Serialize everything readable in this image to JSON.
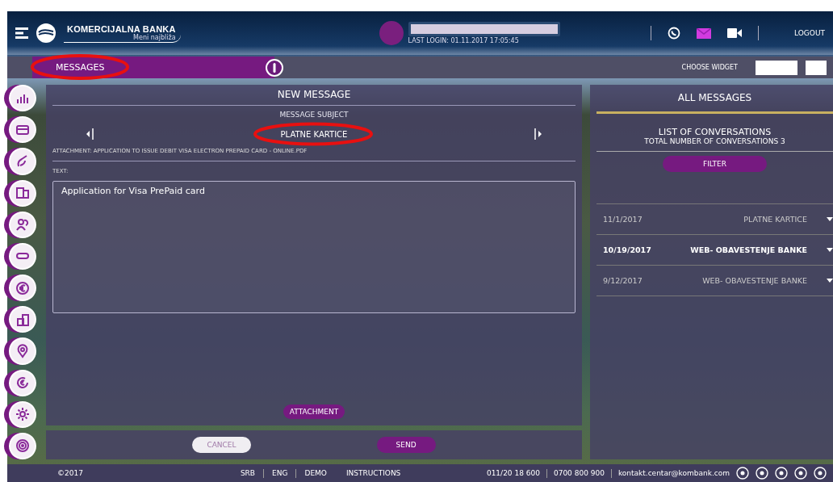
{
  "header": {
    "bank_name": "KOMERCIJALNA BANKA",
    "slogan": "Meni najbliža",
    "last_login": "LAST LOGIN: 01.11.2017 17:05:45",
    "logout": "LOGOUT"
  },
  "widget_bar": {
    "title": "MESSAGES",
    "choose_widget": "CHOOSE WIDGET"
  },
  "new_message": {
    "title": "NEW MESSAGE",
    "subject_label": "MESSAGE SUBJECT",
    "subject": "PLATNE KARTICE",
    "attachment": "ATTACHMENT: APPLICATION TO ISSUE DEBIT VISA ELECTRON PREPAID CARD - ONLINE.PDF",
    "text_label": "TEXT:",
    "text": "Application for Visa PrePaid card",
    "attachment_button": "ATTACHMENT",
    "cancel_button": "CANCEL",
    "send_button": "SEND"
  },
  "all_messages": {
    "title": "ALL MESSAGES",
    "list_title": "LIST OF CONVERSATIONS",
    "total": "TOTAL NUMBER OF CONVERSATIONS 3",
    "filter_button": "FILTER",
    "conversations": [
      {
        "date": "11/1/2017",
        "subject": "PLATNE KARTICE",
        "selected": false
      },
      {
        "date": "10/19/2017",
        "subject": "WEB- OBAVESTENJE BANKE",
        "selected": true
      },
      {
        "date": "9/12/2017",
        "subject": "WEB- OBAVESTENJE BANKE",
        "selected": false
      }
    ]
  },
  "footer": {
    "copyright": "©2017",
    "links": [
      "SRB",
      "ENG",
      "DEMO"
    ],
    "instructions": "INSTRUCTIONS",
    "phones": [
      "011/20 18 600",
      "0700 800 900"
    ],
    "email": "kontakt.centar@kombank.com"
  }
}
